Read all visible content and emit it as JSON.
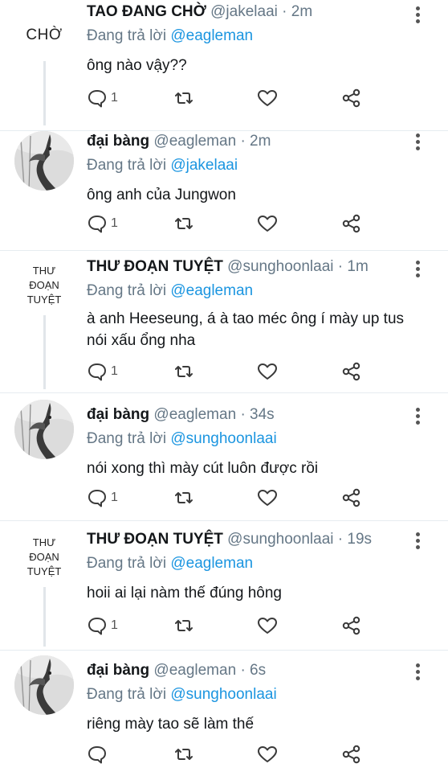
{
  "tweets": [
    {
      "avatar_text": "CHỜ",
      "name": "TAO ĐANG CHỜ",
      "handle": "@jakelaai",
      "separator": "·",
      "time": "2m",
      "reply_prefix": "Đang trả lời",
      "reply_to": "@eagleman",
      "text": "ông nào vậy??",
      "reply_count": "1"
    },
    {
      "avatar_icon": "eagle-photo",
      "name": "đại bàng",
      "handle": "@eagleman",
      "separator": "·",
      "time": "2m",
      "reply_prefix": "Đang trả lời",
      "reply_to": "@jakelaai",
      "text": "ông anh của Jungwon",
      "reply_count": "1"
    },
    {
      "avatar_text": [
        "THƯ",
        "ĐOẠN",
        "TUYỆT"
      ],
      "name": "THƯ ĐOẠN TUYỆT",
      "handle": "@sunghoonlaai",
      "separator": "·",
      "time": "1m",
      "reply_prefix": "Đang trả lời",
      "reply_to": "@eagleman",
      "text": "à anh Heeseung, á à tao méc ông í mày up tus nói xấu ổng nha",
      "reply_count": "1"
    },
    {
      "avatar_icon": "eagle-photo",
      "name": "đại bàng",
      "handle": "@eagleman",
      "separator": "·",
      "time": "34s",
      "reply_prefix": "Đang trả lời",
      "reply_to": "@sunghoonlaai",
      "text": "nói xong thì mày cút luôn được rồi",
      "reply_count": "1"
    },
    {
      "avatar_text": [
        "THƯ",
        "ĐOẠN",
        "TUYỆT"
      ],
      "name": "THƯ ĐOẠN TUYỆT",
      "handle": "@sunghoonlaai",
      "separator": "·",
      "time": "19s",
      "reply_prefix": "Đang trả lời",
      "reply_to": "@eagleman",
      "text": "hoii ai lại nàm thế đúng hông",
      "reply_count": "1"
    },
    {
      "avatar_icon": "eagle-photo",
      "name": "đại bàng",
      "handle": "@eagleman",
      "separator": "·",
      "time": "6s",
      "reply_prefix": "Đang trả lời",
      "reply_to": "@sunghoonlaai",
      "text": "riêng mày tao sẽ làm thế",
      "reply_count": ""
    }
  ],
  "icons": {
    "reply": "comment-bubble-icon",
    "retweet": "retweet-icon",
    "like": "heart-icon",
    "share": "share-icon",
    "more": "more-vertical-icon"
  },
  "colors": {
    "mention": "#1b95e0",
    "secondary_text": "#657786",
    "divider": "#e6ecf0"
  }
}
